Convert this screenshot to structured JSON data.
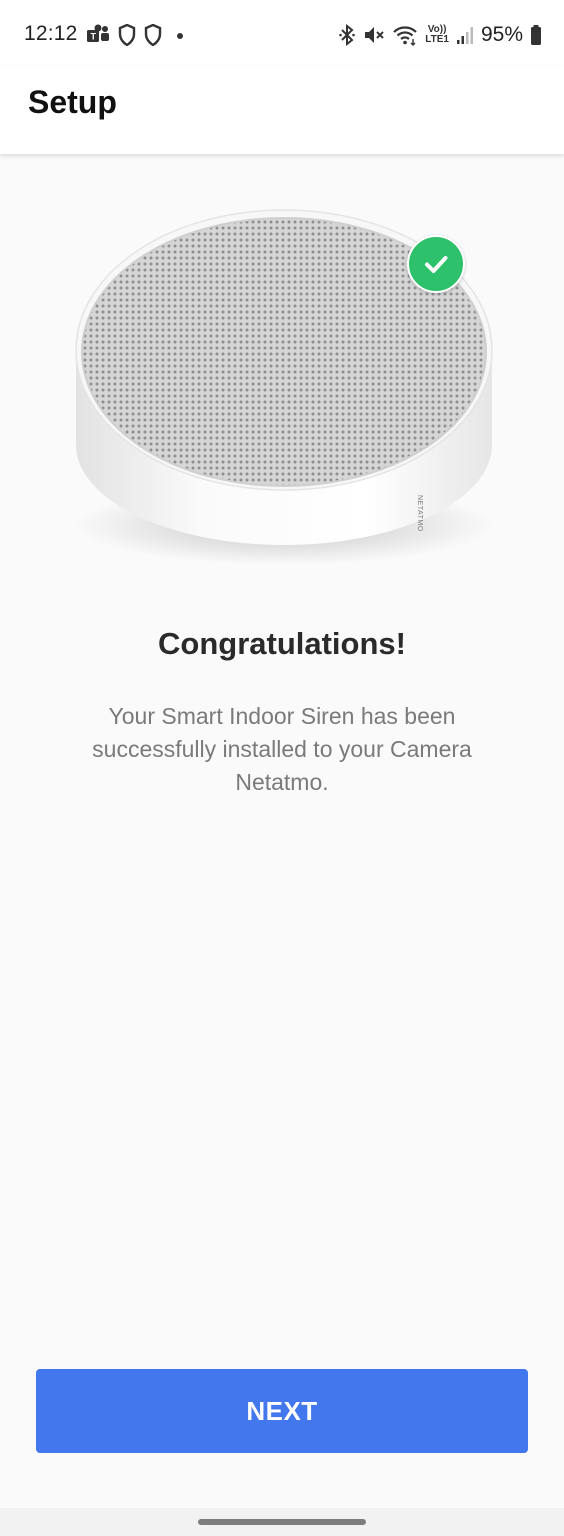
{
  "status_bar": {
    "time": "12:12",
    "battery_percent": "95%",
    "icons_left": [
      "teams-icon",
      "shield-icon",
      "shield-icon",
      "notification-dot"
    ],
    "icons_right": [
      "bluetooth-icon",
      "mute-icon",
      "wifi-icon",
      "volte-icon",
      "signal-icon",
      "battery-icon"
    ],
    "volte_label": "Vo))",
    "lte_label": "LTE1"
  },
  "app_bar": {
    "title": "Setup"
  },
  "device": {
    "brand_text": "NETATMO",
    "status": "installed",
    "badge_color": "#2ec16b"
  },
  "content": {
    "headline": "Congratulations!",
    "message": "Your Smart Indoor Siren has been successfully installed to your Camera Netatmo."
  },
  "actions": {
    "next_label": "NEXT",
    "next_color": "#4277ee"
  }
}
